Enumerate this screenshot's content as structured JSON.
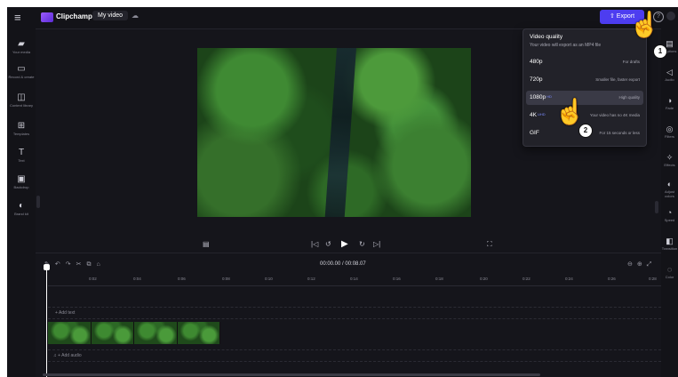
{
  "header": {
    "menu_icon": "hamburger-icon",
    "app_name": "Clipchamp",
    "project_tab": "My video",
    "export_label": "Export",
    "export_icon": "upload-icon",
    "help_icon": "help-icon"
  },
  "left_sidebar": {
    "items": [
      {
        "label": "Your media",
        "icon": "folder-icon"
      },
      {
        "label": "Record & create",
        "icon": "camera-icon"
      },
      {
        "label": "Content library",
        "icon": "library-icon"
      },
      {
        "label": "Templates",
        "icon": "templates-icon"
      },
      {
        "label": "Text",
        "icon": "text-icon"
      },
      {
        "label": "Backdrop",
        "icon": "backdrop-icon"
      },
      {
        "label": "Brand kit",
        "icon": "brand-kit-icon"
      }
    ]
  },
  "right_sidebar": {
    "items": [
      {
        "label": "Captions",
        "icon": "captions-icon"
      },
      {
        "label": "Audio",
        "icon": "audio-icon"
      },
      {
        "label": "Fade",
        "icon": "fade-icon"
      },
      {
        "label": "Filters",
        "icon": "filters-icon"
      },
      {
        "label": "Effects",
        "icon": "effects-icon"
      },
      {
        "label": "Adjust colors",
        "icon": "adjust-colors-icon"
      },
      {
        "label": "Speed",
        "icon": "speed-icon"
      },
      {
        "label": "Transition",
        "icon": "transition-icon"
      },
      {
        "label": "Color",
        "icon": "color-icon"
      }
    ]
  },
  "export_menu": {
    "title": "Video quality",
    "subtitle": "Your video will export as an MP4 file",
    "options": [
      {
        "name": "480p",
        "badge": "",
        "desc": "For drafts"
      },
      {
        "name": "720p",
        "badge": "",
        "desc": "Smaller file, faster export"
      },
      {
        "name": "1080p",
        "badge": "HD",
        "desc": "High quality"
      },
      {
        "name": "4K",
        "badge": "UHD",
        "desc": "Your video has no 4K media"
      },
      {
        "name": "GIF",
        "badge": "",
        "desc": "For 15 seconds or less"
      }
    ],
    "selected_index": 2
  },
  "player": {
    "timecode": "00:00.00 / 00:08.07"
  },
  "timeline": {
    "ticks": [
      "0:02",
      "0:04",
      "0:06",
      "0:08",
      "0:10",
      "0:12",
      "0:14",
      "0:16",
      "0:18",
      "0:20",
      "0:22",
      "0:24",
      "0:26",
      "0:28"
    ],
    "add_text": "+ Add text",
    "add_audio": "+ Add audio"
  },
  "annotations": {
    "step1": "1",
    "step2": "2"
  }
}
